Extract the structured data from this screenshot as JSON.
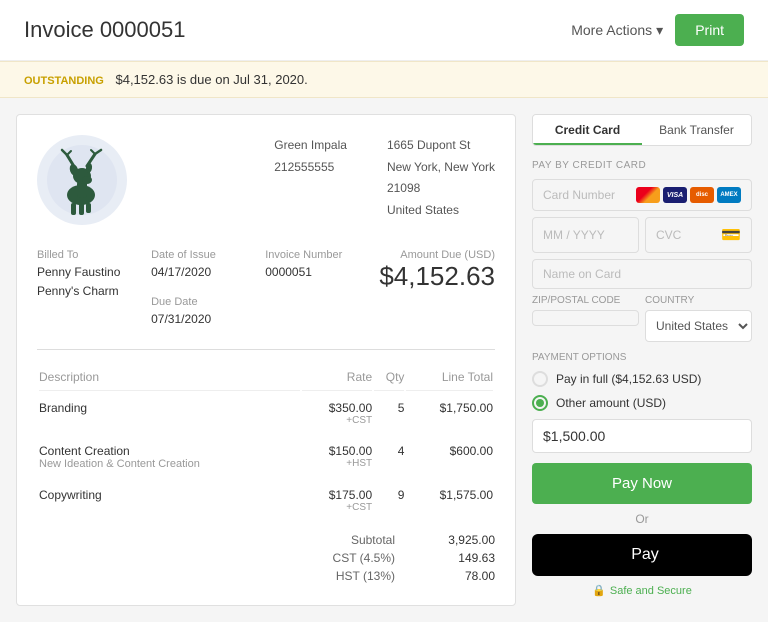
{
  "header": {
    "title": "Invoice 0000051",
    "more_actions_label": "More Actions",
    "print_label": "Print"
  },
  "outstanding_bar": {
    "status_label": "OUTSTANDING",
    "message": "$4,152.63 is due on Jul 31, 2020."
  },
  "invoice": {
    "company": {
      "name": "Green Impala",
      "phone": "212555555"
    },
    "address": {
      "street": "1665 Dupont St",
      "city_state": "New York, New York",
      "zip": "21098",
      "country": "United States"
    },
    "billed_to_label": "Billed To",
    "billed_to": "Penny Faustino\nPenny's Charm",
    "date_of_issue_label": "Date of Issue",
    "date_of_issue": "04/17/2020",
    "invoice_number_label": "Invoice Number",
    "invoice_number": "0000051",
    "due_date_label": "Due Date",
    "due_date": "07/31/2020",
    "amount_due_label": "Amount Due (USD)",
    "amount_due": "$4,152.63",
    "items": [
      {
        "description": "Branding",
        "subtitle": "",
        "rate": "$350.00",
        "rate_note": "+CST",
        "qty": "5",
        "line_total": "$1,750.00"
      },
      {
        "description": "Content Creation",
        "subtitle": "New Ideation & Content Creation",
        "rate": "$150.00",
        "rate_note": "+HST",
        "qty": "4",
        "line_total": "$600.00"
      },
      {
        "description": "Copywriting",
        "subtitle": "",
        "rate": "$175.00",
        "rate_note": "+CST",
        "qty": "9",
        "line_total": "$1,575.00"
      }
    ],
    "table_headers": {
      "description": "Description",
      "rate": "Rate",
      "qty": "Qty",
      "line_total": "Line Total"
    },
    "subtotal_label": "Subtotal",
    "subtotal": "3,925.00",
    "cst_label": "CST (4.5%)",
    "cst": "149.63",
    "hst_label": "HST (13%)",
    "hst": "78.00"
  },
  "payment": {
    "tabs": [
      {
        "label": "Credit Card",
        "active": true
      },
      {
        "label": "Bank Transfer",
        "active": false
      }
    ],
    "section_label": "PAY BY CREDIT CARD",
    "card_number_placeholder": "Card Number",
    "expiry_placeholder": "MM / YYYY",
    "cvc_placeholder": "CVC",
    "name_placeholder": "Name on Card",
    "zip_label": "ZIP/POSTAL CODE",
    "country_label": "COUNTRY",
    "country_value": "United States",
    "payment_options_label": "PAYMENT OPTIONS",
    "pay_full_label": "Pay in full ($4,152.63 USD)",
    "other_amount_label": "Other amount (USD)",
    "other_amount_value": "$1,500.00",
    "pay_now_label": "Pay Now",
    "or_label": "Or",
    "apple_pay_label": "Pay",
    "secure_label": "Safe and Secure"
  }
}
